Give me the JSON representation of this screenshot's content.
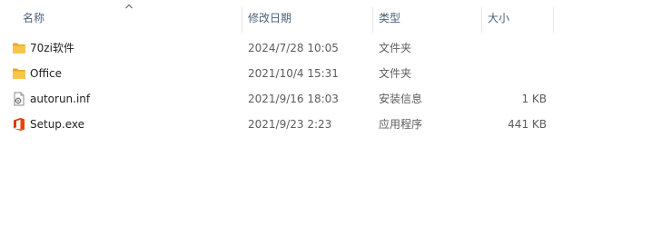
{
  "columns": {
    "name": "名称",
    "date": "修改日期",
    "type": "类型",
    "size": "大小"
  },
  "sort": {
    "column": "name",
    "direction": "ascending"
  },
  "files": [
    {
      "name": "70zi软件",
      "modified": "2024/7/28 10:05",
      "type": "文件夹",
      "size": "",
      "icon": "folder-icon"
    },
    {
      "name": "Office",
      "modified": "2021/10/4 15:31",
      "type": "文件夹",
      "size": "",
      "icon": "folder-icon"
    },
    {
      "name": "autorun.inf",
      "modified": "2021/9/16 18:03",
      "type": "安装信息",
      "size": "1 KB",
      "icon": "setup-info-file-icon"
    },
    {
      "name": "Setup.exe",
      "modified": "2021/9/23 2:23",
      "type": "应用程序",
      "size": "441 KB",
      "icon": "office-setup-exe-icon"
    }
  ],
  "colors": {
    "header_text": "#4c607a",
    "folder": "#f6c64a",
    "office": "#d83b01"
  }
}
